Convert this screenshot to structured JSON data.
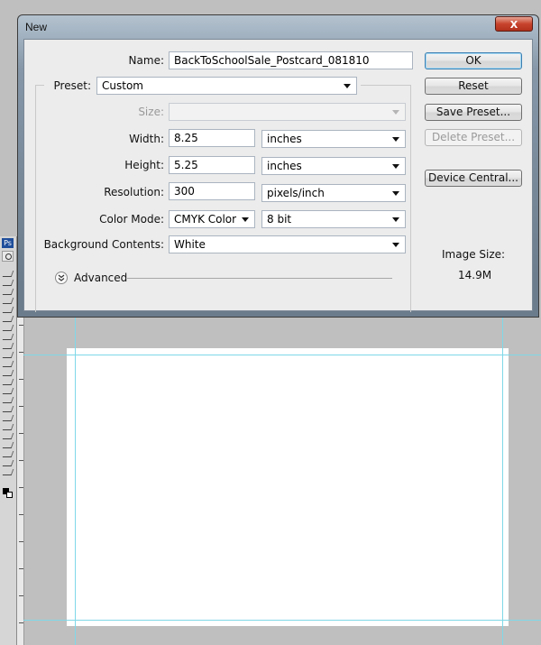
{
  "dialog": {
    "title": "New",
    "close_label": "X",
    "name_label": "Name:",
    "name_value": "BackToSchoolSale_Postcard_081810",
    "preset_label": "Preset:",
    "preset_value": "Custom",
    "size_label": "Size:",
    "size_value": "",
    "width_label": "Width:",
    "width_value": "8.25",
    "width_unit": "inches",
    "height_label": "Height:",
    "height_value": "5.25",
    "height_unit": "inches",
    "resolution_label": "Resolution:",
    "resolution_value": "300",
    "resolution_unit": "pixels/inch",
    "color_mode_label": "Color Mode:",
    "color_mode_value": "CMYK Color",
    "bit_depth_value": "8 bit",
    "background_label": "Background Contents:",
    "background_value": "White",
    "advanced_label": "Advanced",
    "image_size_label": "Image Size:",
    "image_size_value": "14.9M",
    "buttons": {
      "ok": "OK",
      "reset": "Reset",
      "save_preset": "Save Preset...",
      "delete_preset": "Delete Preset...",
      "device_central": "Device Central..."
    }
  },
  "workspace": {
    "canvas_color": "#ffffff",
    "background_color": "#bfbfbf",
    "guide_color": "#7fd8e8",
    "toolbox_logo": "Ps"
  }
}
